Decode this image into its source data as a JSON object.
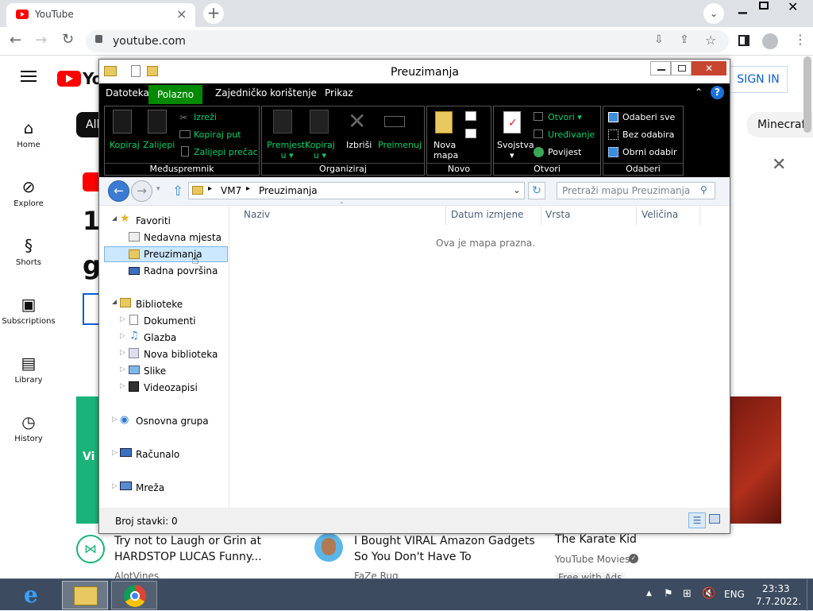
{
  "browser": {
    "tab_title": "YouTube",
    "url": "youtube.com"
  },
  "youtube": {
    "nav": [
      {
        "label": "Home",
        "icon": "home-icon"
      },
      {
        "label": "Explore",
        "icon": "compass-icon"
      },
      {
        "label": "Shorts",
        "icon": "shorts-icon"
      },
      {
        "label": "Subscriptions",
        "icon": "subscriptions-icon"
      },
      {
        "label": "Library",
        "icon": "library-icon"
      },
      {
        "label": "History",
        "icon": "history-icon"
      }
    ],
    "sign_in": "SIGN IN",
    "chip_all": "All",
    "chip_minecraft": "Minecraft",
    "videos": [
      {
        "title_line1": "Try not to Laugh or Grin at",
        "title_line2": "HARDSTOP LUCAS Funny...",
        "channel": "AlotVines"
      },
      {
        "title_line1": "I Bought VIRAL Amazon Gadgets",
        "title_line2": "So You Don't Have To",
        "channel": "FaZe Rug"
      },
      {
        "title_line1": "The Karate Kid",
        "title_line2": "",
        "channel": "YouTube Movies",
        "extra": "Free with Ads"
      }
    ]
  },
  "explorer": {
    "title": "Preuzimanja",
    "menu": {
      "file": "Datoteka",
      "home": "Polazno",
      "share": "Zajedničko korištenje",
      "view": "Prikaz"
    },
    "ribbon": {
      "clipboard": {
        "label": "Međuspremnik",
        "copy": "Kopiraj",
        "paste": "Zalijepi",
        "cut": "Izreži",
        "copy_path": "Kopiraj put",
        "paste_shortcut": "Zalijepi prečac"
      },
      "organize": {
        "label": "Organiziraj",
        "move_1": "Premjesti",
        "move_2": "u",
        "copy_1": "Kopiraj",
        "copy_2": "u",
        "delete": "Izbriši",
        "rename": "Preimenuj"
      },
      "new": {
        "label": "Novo",
        "folder_1": "Nova",
        "folder_2": "mapa"
      },
      "open": {
        "label": "Otvori",
        "properties": "Svojstva",
        "open": "Otvori",
        "edit": "Uređivanje",
        "history": "Povijest"
      },
      "select": {
        "label": "Odaberi",
        "all": "Odaberi sve",
        "none": "Bez odabira",
        "invert": "Obrni odabir"
      }
    },
    "address": {
      "root": "VM7",
      "current": "Preuzimanja"
    },
    "search_placeholder": "Pretraži mapu Preuzimanja",
    "tree": {
      "favorites": "Favoriti",
      "recent": "Nedavna mjesta",
      "downloads": "Preuzimanja",
      "desktop": "Radna površina",
      "libraries": "Biblioteke",
      "documents": "Dokumenti",
      "music": "Glazba",
      "new_library": "Nova biblioteka",
      "pictures": "Slike",
      "videos": "Videozapisi",
      "homegroup": "Osnovna grupa",
      "computer": "Računalo",
      "network": "Mreža"
    },
    "columns": [
      "Naziv",
      "Datum izmjene",
      "Vrsta",
      "Veličina"
    ],
    "empty_text": "Ova je mapa prazna.",
    "status": "Broj stavki: 0"
  },
  "taskbar": {
    "lang": "ENG",
    "time": "23:33",
    "date": "7.7.2022."
  },
  "colors": {
    "ribbon_green": "#00d26a",
    "polazno_tab": "#008a00",
    "yt_red": "#ff0000"
  }
}
